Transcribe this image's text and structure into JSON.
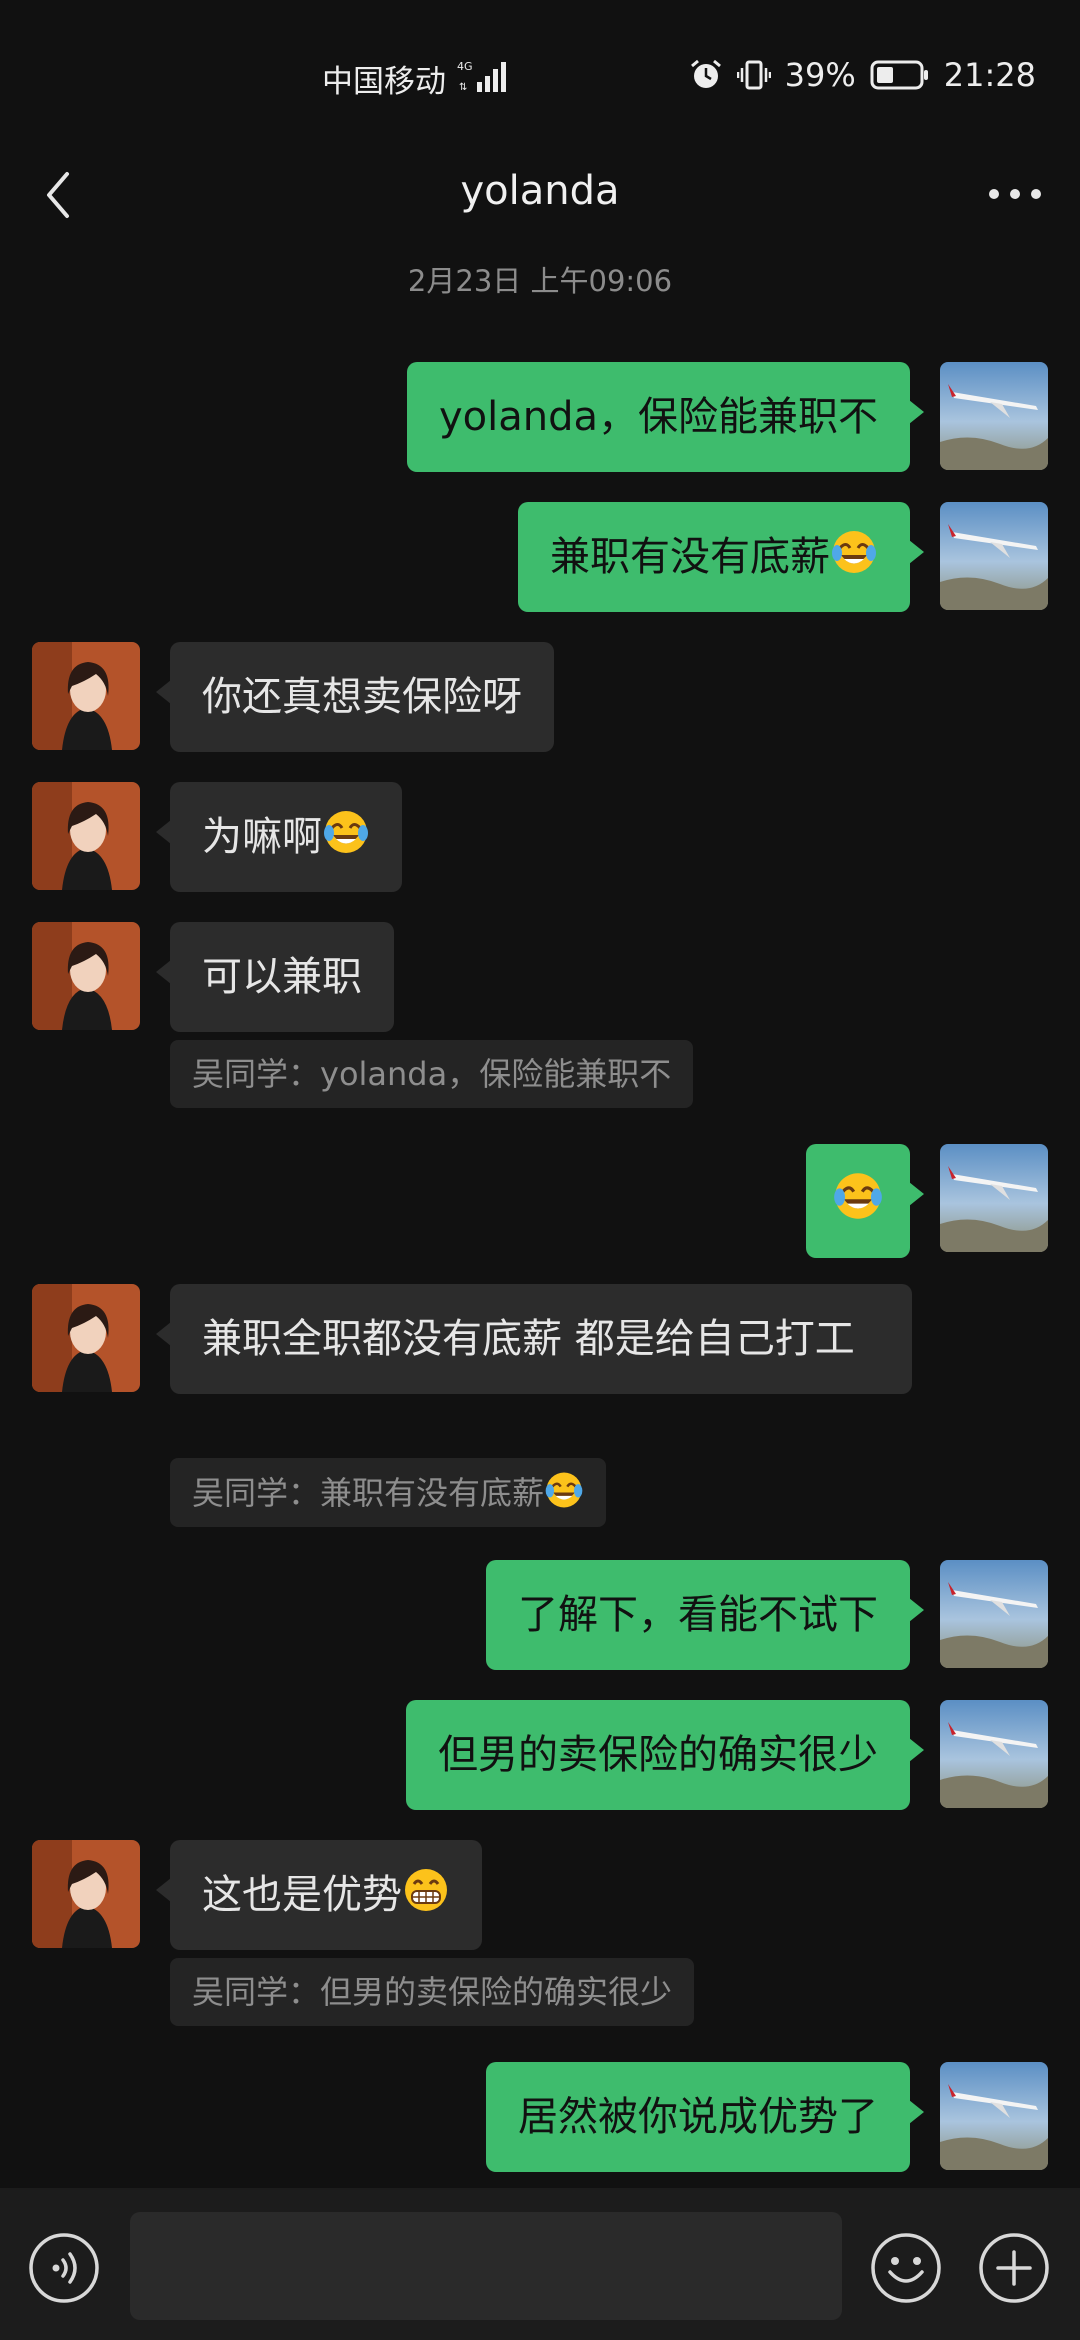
{
  "status_bar": {
    "carrier": "中国移动",
    "network": "4G",
    "battery": "39%",
    "time": "21:28"
  },
  "header": {
    "back_icon": "chevron-left-icon",
    "title": "yolanda",
    "more_icon": "more-dots-icon"
  },
  "timestamp": "2月23日 上午09:06",
  "messages": [
    {
      "side": "out",
      "text": "yolanda，保险能兼职不"
    },
    {
      "side": "out",
      "text": "兼职有没有底薪",
      "emoji": "tears-of-joy"
    },
    {
      "side": "in",
      "text": "你还真想卖保险呀"
    },
    {
      "side": "in",
      "text": "为嘛啊",
      "emoji": "tears-of-joy"
    },
    {
      "side": "in",
      "text": "可以兼职",
      "quote": "吴同学：yolanda，保险能兼职不"
    },
    {
      "side": "out",
      "text": "",
      "emoji": "tears-of-joy"
    },
    {
      "side": "in",
      "text": "兼职全职都没有底薪 都是给自己打工",
      "quote": "吴同学：兼职有没有底薪"
    },
    {
      "side": "out",
      "text": "了解下，看能不试下"
    },
    {
      "side": "out",
      "text": "但男的卖保险的确实很少"
    },
    {
      "side": "in",
      "text": "这也是优势",
      "emoji": "grin",
      "quote": "吴同学：但男的卖保险的确实很少"
    },
    {
      "side": "out",
      "text": "居然被你说成优势了"
    }
  ],
  "quote_emoji": "tears-of-joy",
  "input_bar": {
    "voice_icon": "voice-icon",
    "input_value": "",
    "emoji_icon": "emoji-icon",
    "plus_icon": "plus-icon"
  },
  "colors": {
    "background": "#111111",
    "outgoing_bubble": "#3ebc6d",
    "incoming_bubble": "#2c2c2c"
  }
}
